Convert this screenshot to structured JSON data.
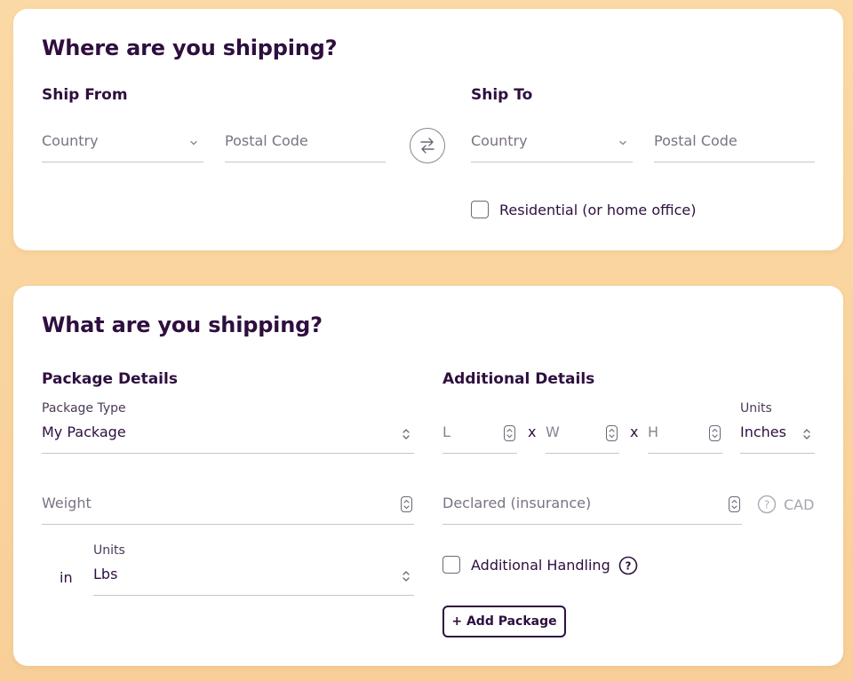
{
  "shipping_where": {
    "title": "Where are you shipping?",
    "ship_from": {
      "heading": "Ship From",
      "country_placeholder": "Country",
      "postal_placeholder": "Postal Code"
    },
    "ship_to": {
      "heading": "Ship To",
      "country_placeholder": "Country",
      "postal_placeholder": "Postal Code"
    },
    "residential_label": "Residential (or home office)",
    "residential_checked": false,
    "swap_icon": "swap-arrows-icon"
  },
  "shipping_what": {
    "title": "What are you shipping?",
    "package_details": {
      "heading": "Package Details",
      "package_type_label": "Package Type",
      "package_type_value": "My Package",
      "weight_placeholder": "Weight",
      "in_label": "in",
      "units_label": "Units",
      "units_value": "Lbs"
    },
    "additional_details": {
      "heading": "Additional Details",
      "length_placeholder": "L",
      "width_placeholder": "W",
      "height_placeholder": "H",
      "times_symbol": "x",
      "dim_units_label": "Units",
      "dim_units_value": "Inches",
      "declared_placeholder": "Declared (insurance)",
      "currency": "CAD",
      "additional_handling_label": "Additional Handling",
      "additional_handling_checked": false,
      "add_package_label": "+ Add Package"
    }
  },
  "colors": {
    "background": "#f8cf98",
    "text_primary": "#2e0f3f",
    "card": "#ffffff"
  }
}
